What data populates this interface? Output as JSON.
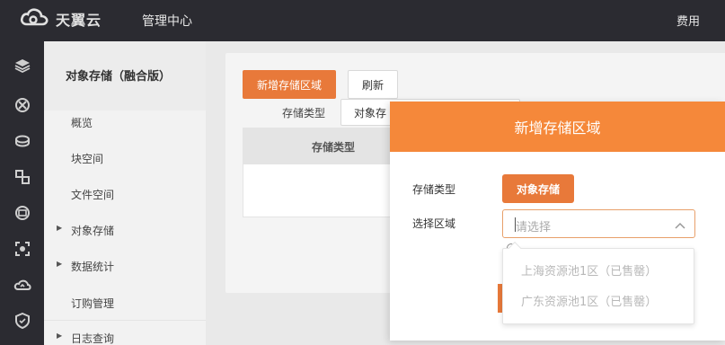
{
  "header": {
    "brand": "天翼云",
    "nav_title": "管理中心",
    "right_link": "费用"
  },
  "rail": {
    "icons": [
      "layers-icon",
      "network-icon",
      "storage-icon",
      "transfer-icon",
      "database-icon",
      "security-scan-icon",
      "cloud-sync-icon",
      "shield-icon"
    ]
  },
  "sidebar": {
    "title": "对象存储（融合版）",
    "items": [
      {
        "label": "概览",
        "expandable": false
      },
      {
        "label": "块空间",
        "expandable": false
      },
      {
        "label": "文件空间",
        "expandable": false
      },
      {
        "label": "对象存储",
        "expandable": true
      },
      {
        "label": "数据统计",
        "expandable": true
      },
      {
        "label": "订购管理",
        "expandable": false
      },
      {
        "label": "日志查询",
        "expandable": true
      }
    ]
  },
  "main": {
    "add_button": "新增存储区域",
    "refresh_button": "刷新",
    "filter_label": "存储类型",
    "filter_value": "对象存",
    "table_header": "存储类型"
  },
  "modal": {
    "title": "新增存储区域",
    "type_label": "存储类型",
    "type_value": "对象存储",
    "region_label": "选择区域",
    "region_placeholder": "请选择",
    "options": [
      {
        "label": "上海资源池1区（已售罄）",
        "disabled": true
      },
      {
        "label": "广东资源池1区（已售罄）",
        "disabled": true
      }
    ]
  },
  "colors": {
    "topbar": "#2b2b31",
    "accent": "#e8793a",
    "modal_header": "#f5883a"
  }
}
